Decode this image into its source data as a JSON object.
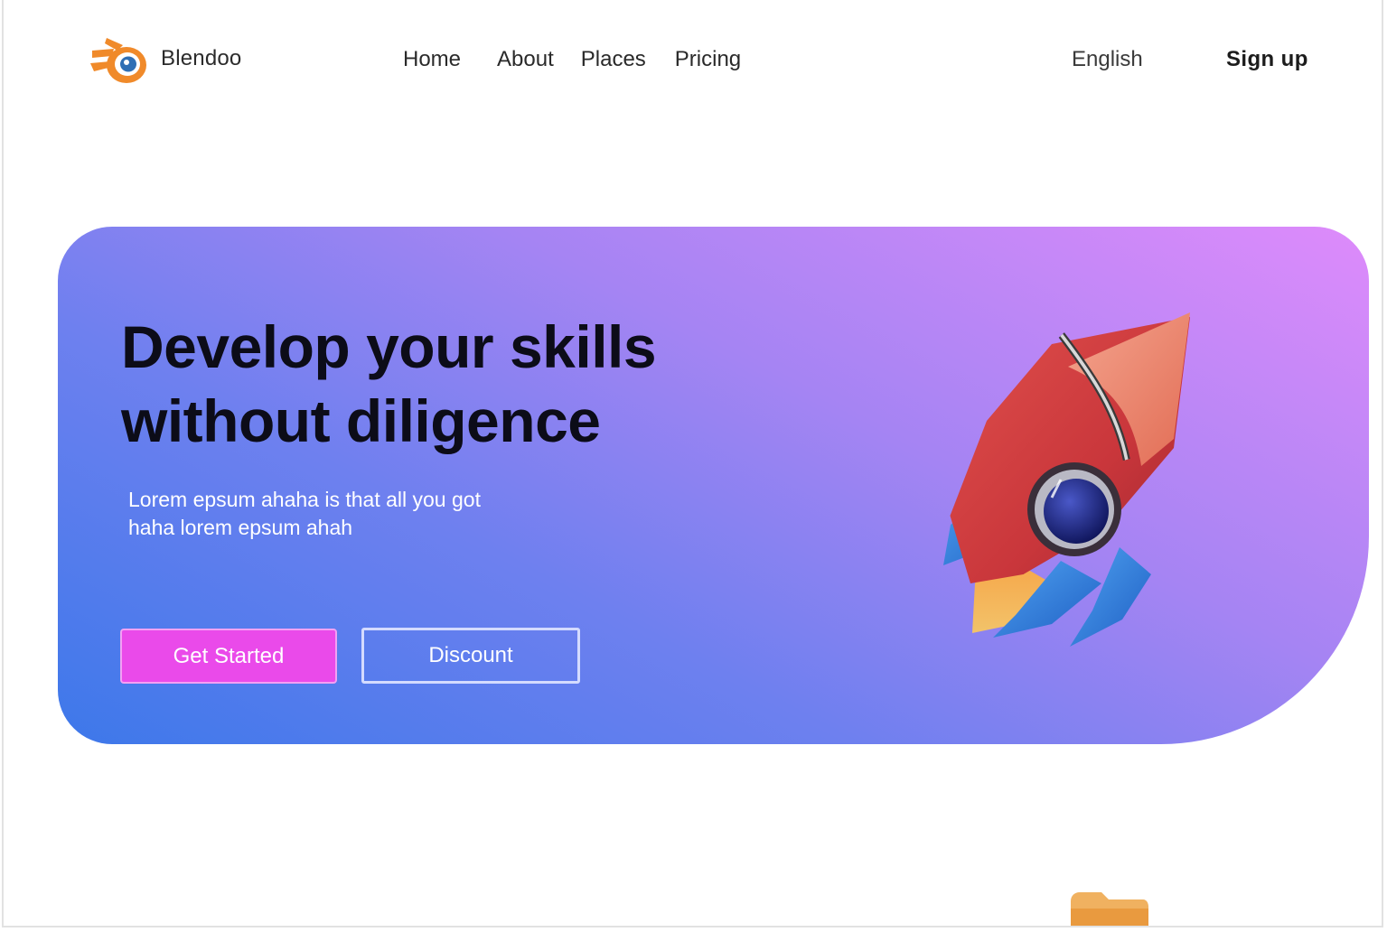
{
  "brand": {
    "name": "Blendoo",
    "logo_icon": "blender-logo-icon",
    "logo_color": "#f08a2a"
  },
  "nav": {
    "items": [
      {
        "label": "Home"
      },
      {
        "label": "About"
      },
      {
        "label": "Places"
      },
      {
        "label": "Pricing"
      }
    ]
  },
  "header": {
    "language": "English",
    "signup": "Sign  up"
  },
  "hero": {
    "title_line1": "Develop your skills",
    "title_line2": "without diligence",
    "subtitle_line1": "Lorem epsum ahaha is that all you got",
    "subtitle_line2": "haha lorem epsum ahah",
    "primary_button": "Get Started",
    "secondary_button": "Discount",
    "illustration_icon": "rocket-icon",
    "gradient_colors": [
      "#3d78ea",
      "#a584f3",
      "#de8bfb"
    ],
    "primary_button_color": "#ea4aea"
  },
  "below_fold": {
    "illustration_icon": "folder-icon"
  }
}
